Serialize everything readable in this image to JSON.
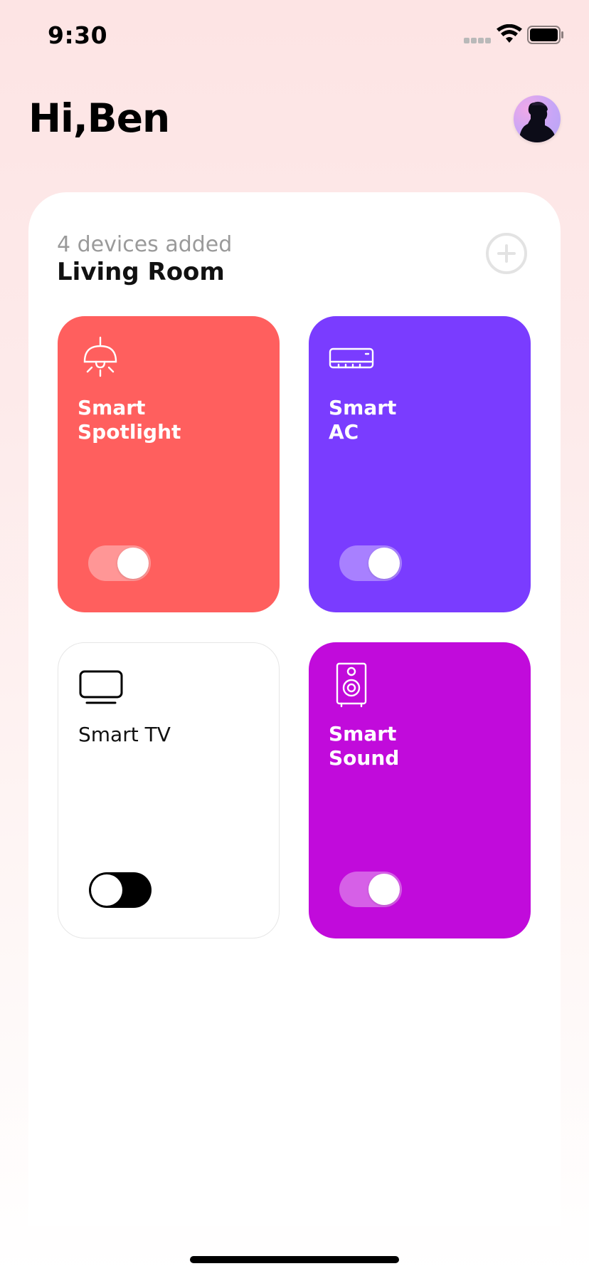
{
  "status_bar": {
    "time": "9:30"
  },
  "header": {
    "greeting": "Hi,Ben"
  },
  "room": {
    "devices_count": "4 devices added",
    "name": "Living Room"
  },
  "devices": [
    {
      "label": "Smart\nSpotlight",
      "icon": "ceiling-lamp-icon",
      "color": "#ff5f5e",
      "on": true
    },
    {
      "label": "Smart\nAC",
      "icon": "air-conditioner-icon",
      "color": "#7a3cff",
      "on": true
    },
    {
      "label": "Smart TV",
      "icon": "tv-icon",
      "color": "#ffffff",
      "on": false
    },
    {
      "label": "Smart\nSound",
      "icon": "speaker-icon",
      "color": "#c10bdb",
      "on": true
    }
  ]
}
